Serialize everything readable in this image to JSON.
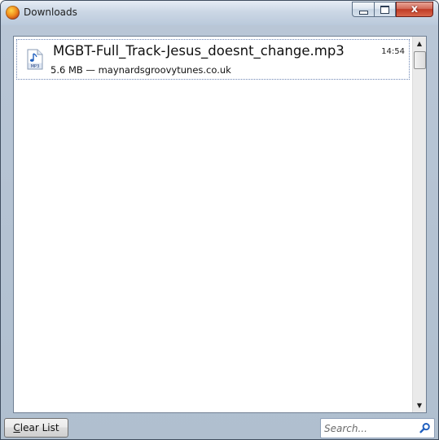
{
  "window": {
    "title": "Downloads",
    "close_glyph": "x"
  },
  "downloads": [
    {
      "filename": "MGBT-Full_Track-Jesus_doesnt_change.mp3",
      "status": "5.6 MB — maynardsgroovytunes.co.uk",
      "time": "14:54",
      "icon_label": "MP3"
    }
  ],
  "footer": {
    "clear_button_accel": "C",
    "clear_button_rest": "lear List",
    "search_placeholder": "Search..."
  },
  "colors": {
    "accent_blue": "#1f5fbf",
    "close_red": "#bf3b26"
  },
  "icons": {
    "app": "firefox-icon",
    "file": "mp3-file-icon",
    "search": "search-icon"
  }
}
